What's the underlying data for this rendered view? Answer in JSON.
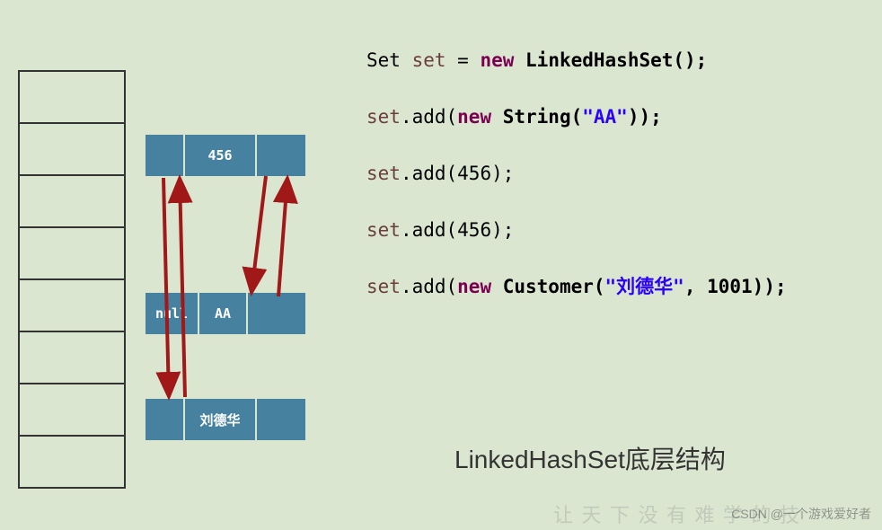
{
  "diagram": {
    "title": "LinkedHashSet底层结构",
    "node_456": {
      "prev": "",
      "value": "456",
      "next": ""
    },
    "node_aa": {
      "prev": "null",
      "value": "AA",
      "next": ""
    },
    "node_liu": {
      "prev": "",
      "value": "刘德华",
      "next": ""
    }
  },
  "code": {
    "line1_1": "Set ",
    "line1_2": "set",
    "line1_3": " = ",
    "line1_4": "new",
    "line1_5": " LinkedHashSet();",
    "line2_1": "set",
    "line2_2": ".add(",
    "line2_3": "new",
    "line2_4": " String(",
    "line2_5": "\"AA\"",
    "line2_6": "));",
    "line3_1": "set",
    "line3_2": ".add(456);",
    "line4_1": "set",
    "line4_2": ".add(456);",
    "line5_1": "set",
    "line5_2": ".add(",
    "line5_3": "new",
    "line5_4": " Customer(",
    "line5_5": "\"刘德华\"",
    "line5_6": ", 1001));"
  },
  "watermark": "CSDN @一个游戏爱好者",
  "watermark2": "让 天 下 没 有 难 学 的 技"
}
